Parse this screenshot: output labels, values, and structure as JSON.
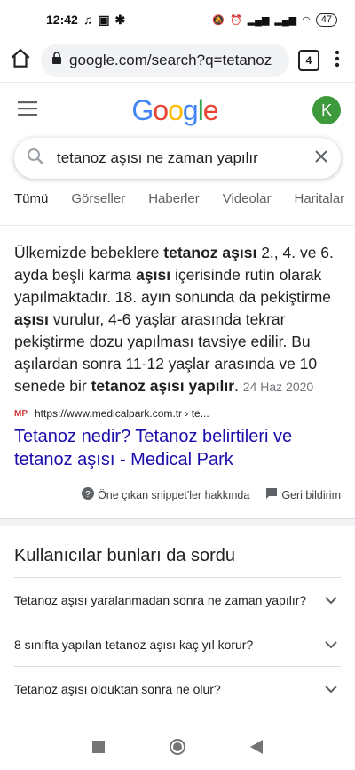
{
  "status_bar": {
    "time": "12:42",
    "battery": "47"
  },
  "browser": {
    "url": "google.com/search?q=tetanoz",
    "tab_count": "4"
  },
  "google": {
    "logo": "Google",
    "avatar_letter": "K",
    "query": "tetanoz aşısı ne zaman yapılır"
  },
  "tabs": [
    "Tümü",
    "Görseller",
    "Haberler",
    "Videolar",
    "Haritalar"
  ],
  "snippet": {
    "s1": "Ülkemizde bebeklere ",
    "b1": "tetanoz aşısı",
    "s2": " 2., 4. ve 6. ayda beşli karma ",
    "b2": "aşısı",
    "s3": " içerisinde rutin olarak yapılmaktadır. 18. ayın sonunda da pekiştirme ",
    "b3": "aşısı",
    "s4": " vurulur, 4-6 yaşlar arasında tekrar pekiştirme dozu yapılması tavsiye edilir. Bu aşılardan sonra 11-12 yaşlar arasında ve 10 senede bir ",
    "b4": "tetanoz aşısı yapılır",
    "s5": ".",
    "date": "24 Haz 2020"
  },
  "source": {
    "logo": "MP",
    "url": "https://www.medicalpark.com.tr › te..."
  },
  "result_title": "Tetanoz nedir? Tetanoz belirtileri ve tetanoz aşısı - Medical Park",
  "feedback": {
    "about": "Öne çıkan snippet'ler hakkında",
    "report": "Geri bildirim"
  },
  "paa": {
    "title": "Kullanıcılar bunları da sordu",
    "items": [
      "Tetanoz aşısı yaralanmadan sonra ne zaman yapılır?",
      "8 sınıfta yapılan tetanoz aşısı kaç yıl korur?",
      "Tetanoz aşısı olduktan sonra ne olur?"
    ]
  }
}
